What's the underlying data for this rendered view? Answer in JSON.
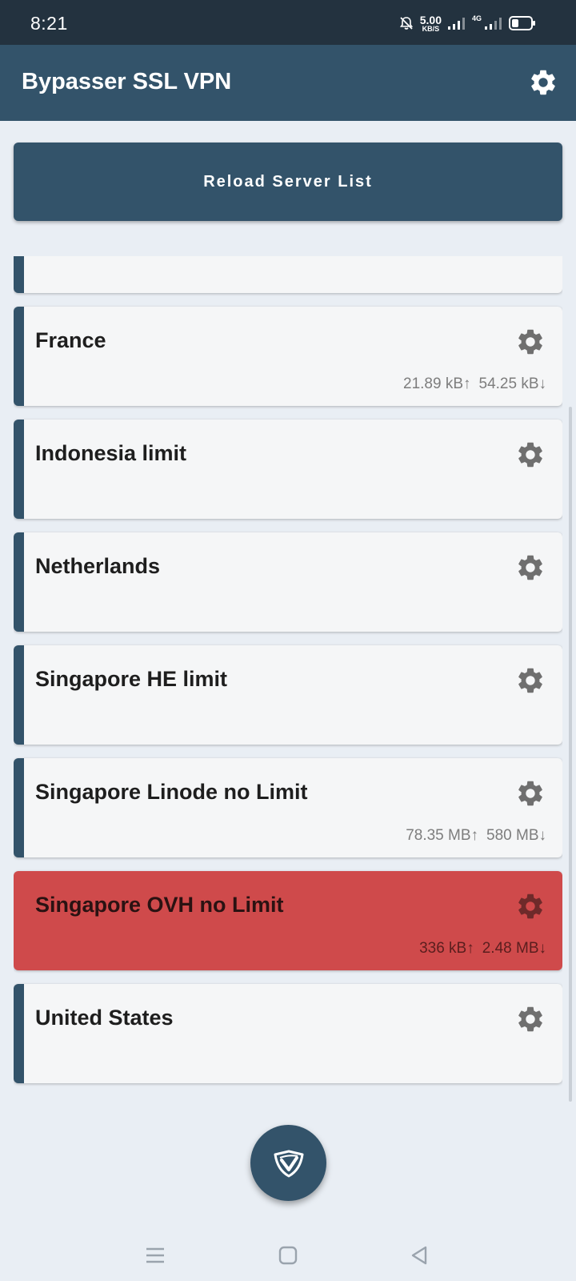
{
  "status_bar": {
    "time": "8:21",
    "speed_value": "5.00",
    "speed_unit": "KB/S",
    "network_label": "4G"
  },
  "app_bar": {
    "title": "Bypasser SSL VPN",
    "settings_icon": "gear-icon"
  },
  "reload_button": {
    "label": "Reload Server List"
  },
  "servers": [
    {
      "name": "",
      "upload": "",
      "download": "",
      "active": false
    },
    {
      "name": "France",
      "upload": "21.89 kB↑",
      "download": "54.25 kB↓",
      "active": false
    },
    {
      "name": "Indonesia limit",
      "upload": "",
      "download": "",
      "active": false
    },
    {
      "name": "Netherlands",
      "upload": "",
      "download": "",
      "active": false
    },
    {
      "name": "Singapore HE limit",
      "upload": "",
      "download": "",
      "active": false
    },
    {
      "name": "Singapore Linode no Limit",
      "upload": "78.35 MB↑",
      "download": "580 MB↓",
      "active": false
    },
    {
      "name": "Singapore OVH no Limit",
      "upload": "336 kB↑",
      "download": "2.48 MB↓",
      "active": true
    },
    {
      "name": "United States",
      "upload": "",
      "download": "",
      "active": false
    }
  ],
  "colors": {
    "primary": "#33536a",
    "active": "#cf4a4b",
    "background": "#e9eef4"
  },
  "fab": {
    "icon": "vpn-shield-logo-icon"
  },
  "nav_bar": {
    "icons": [
      "menu-icon",
      "home-icon",
      "back-icon"
    ]
  }
}
